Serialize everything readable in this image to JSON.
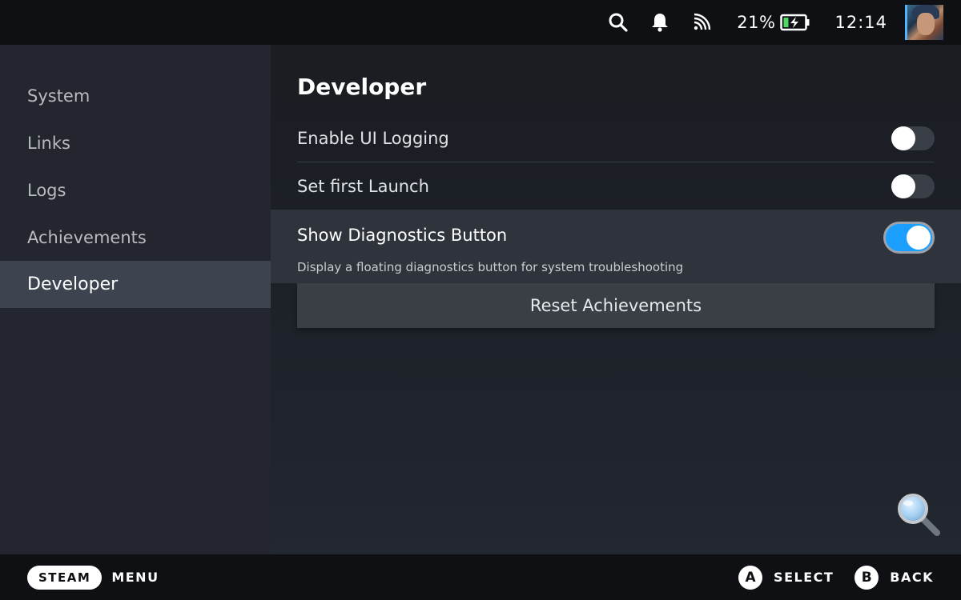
{
  "topbar": {
    "battery_percent": "21%",
    "clock": "12:14",
    "icons": [
      "search-icon",
      "bell-icon",
      "cast-icon",
      "battery-charging-icon"
    ]
  },
  "sidebar": {
    "items": [
      {
        "label": "System"
      },
      {
        "label": "Links"
      },
      {
        "label": "Logs"
      },
      {
        "label": "Achievements"
      },
      {
        "label": "Developer",
        "active": true
      }
    ]
  },
  "main": {
    "title": "Developer",
    "settings": [
      {
        "label": "Enable UI Logging",
        "enabled": false
      },
      {
        "label": "Set first Launch",
        "enabled": false
      },
      {
        "label": "Show Diagnostics Button",
        "enabled": true,
        "description": "Display a floating diagnostics button for system troubleshooting"
      }
    ],
    "reset_button": "Reset Achievements"
  },
  "bottombar": {
    "steam": "STEAM",
    "menu": "MENU",
    "select_key": "A",
    "select": "SELECT",
    "back_key": "B",
    "back": "BACK"
  },
  "colors": {
    "accent": "#1a9fff",
    "sidebar_bg": "#23262e",
    "active_item_bg": "#3d4450",
    "bar_bg": "#0e1014"
  }
}
